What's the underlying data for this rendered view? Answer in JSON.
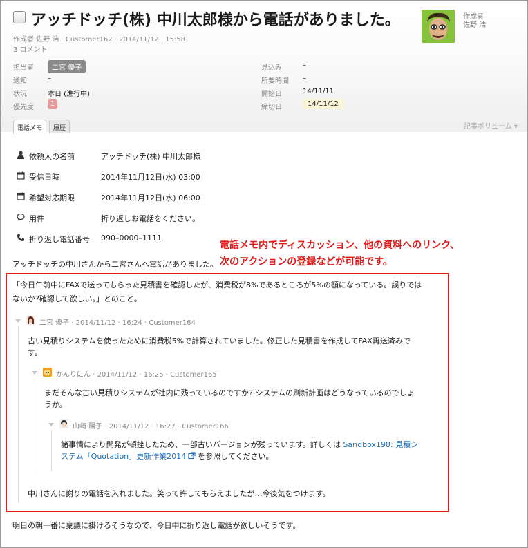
{
  "task": {
    "title": "アッチドッチ(株) 中川太郎様から電話がありました。",
    "meta": "作成者 佐野 浩 · Customer162 · 2014/11/12 · 15:58",
    "comments": "3 コメント",
    "author_label": "作成者",
    "author_name": "佐野 浩"
  },
  "properties": {
    "assignee_label": "担当者",
    "assignee_value": "二宮 優子",
    "notify_label": "通知",
    "notify_value": "–",
    "status_label": "状況",
    "status_value": "本日 (進行中)",
    "priority_label": "優先度",
    "priority_value": "1",
    "estimate_label": "見込み",
    "estimate_value": "–",
    "duration_label": "所要時間",
    "duration_value": "–",
    "start_label": "開始日",
    "start_value": "14/11/11",
    "due_label": "締切日",
    "due_value": "14/11/12"
  },
  "tabs": {
    "memo": "電話メモ",
    "history": "履歴",
    "volume": "記事ボリューム ▾"
  },
  "memo": {
    "requester_label": "依頼人の名前",
    "requester_value": "アッチドッチ(株) 中川太郎様",
    "received_label": "受信日時",
    "received_value": "2014年11月12日(水) 03:00",
    "desired_label": "希望対応期限",
    "desired_value": "2014年11月12日(水) 06:00",
    "subject_label": "用件",
    "subject_value": "折り返しお電話をください。",
    "callback_label": "折り返し電話番号",
    "callback_value": "090–0000–1111"
  },
  "annotation": {
    "line1": "電話メモ内でディスカッション、他の資料へのリンク、",
    "line2": "次のアクションの登録などが可能です。"
  },
  "body": {
    "intro": "アッチドッチの中川さんから二宮さんへ電話がありました。",
    "quote_line1": "「今日午前中にFAXで送ってもらった見積書を確認したが、消費税が8%であるところが5%の額になっている。誤りでは",
    "quote_line2": "ないか?確認して欲しい。」とのこと。",
    "footer": "明日の朝一番に稟議に掛けるそうなので、今日中に折り返し電話が欲しいそうです。"
  },
  "thread": {
    "c1_meta": "二宮 優子 · 2014/11/12 · 16:24 · Customer164",
    "c1_line1": "古い見積りシステムを使ったために消費税5%で計算されていました。修正した見積書を作成してFAX再送済みで",
    "c1_line2": "す。",
    "c2_meta": "かんりにん · 2014/11/12 · 16:25 · Customer165",
    "c2_line1": "まだそんな古い見積りシステムが社内に残っているのですか? システムの刷新計画はどうなっているのでしょ",
    "c2_line2": "うか。",
    "c3_meta": "山﨑 陽子 · 2014/11/12 · 16:27 · Customer166",
    "c3_line1_text": "諸事情により開発が頓挫したため、一部古いバージョンが残っています。詳しくは",
    "c3_link_part1": "Sandbox198: 見積シ",
    "c3_link_part2": "ステム「Quotation」更新作業2014",
    "c3_line2_suffix": "を参照してください。",
    "c4_text": "中川さんに謝りの電話を入れました。笑って許してもらえましたが…今後気をつけます。"
  }
}
